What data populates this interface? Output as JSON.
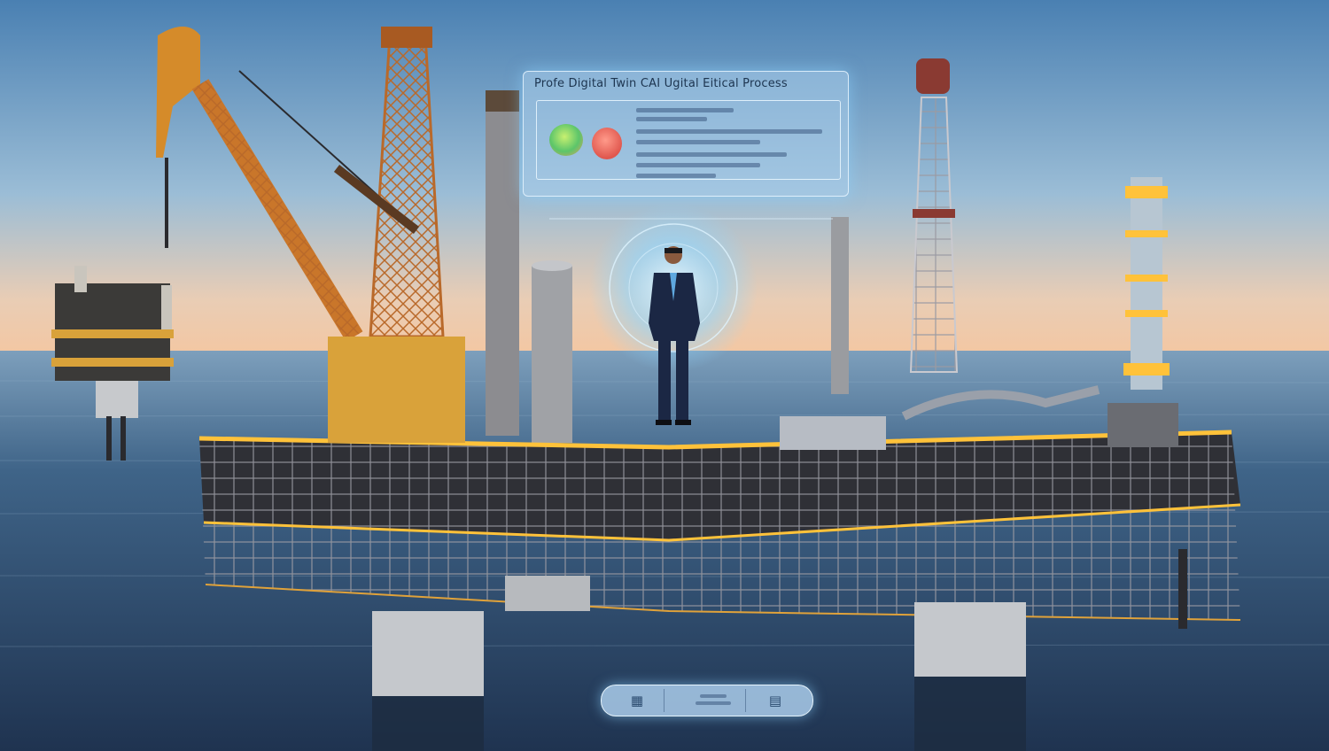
{
  "hologram": {
    "title": "Profe Digital Twin CAI Ugital Eitical Process",
    "indicators": [
      {
        "color": "#6fd36a"
      },
      {
        "color": "#e4584f"
      }
    ]
  },
  "nav": {
    "left_icon": "panel-icon",
    "right_icon": "document-icon"
  },
  "colors": {
    "sky_top": "#4f87b8",
    "sky_horizon": "#f1c7a8",
    "sea": "#2a4a6c",
    "glow": "#ffc23a",
    "steel": "#3d3f45",
    "crane": "#d58b2a",
    "hologram": "#8fd6ff"
  }
}
